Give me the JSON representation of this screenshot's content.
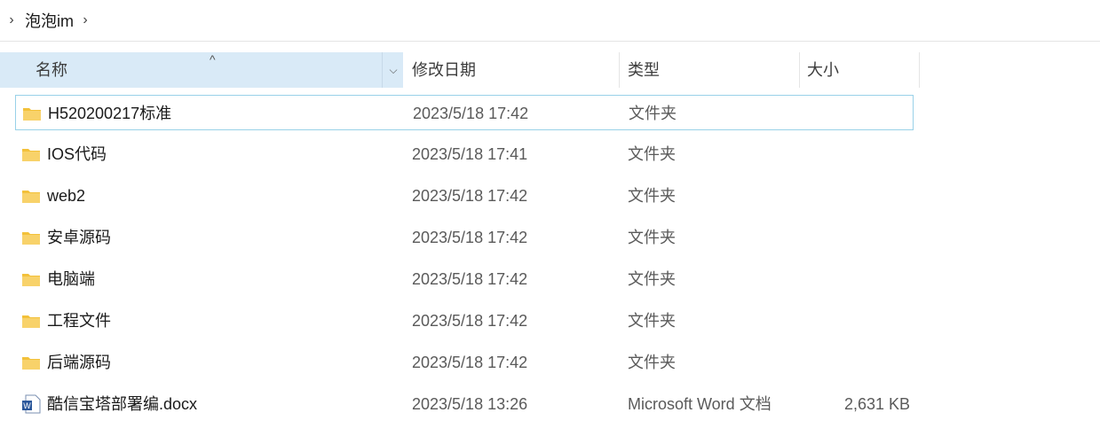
{
  "breadcrumb": {
    "items": [
      "泡泡im"
    ]
  },
  "columns": {
    "name": "名称",
    "date": "修改日期",
    "type": "类型",
    "size": "大小"
  },
  "files": [
    {
      "name": "H520200217标准",
      "date": "2023/5/18 17:42",
      "type": "文件夹",
      "size": "",
      "icon": "folder-icon",
      "selected": true
    },
    {
      "name": "IOS代码",
      "date": "2023/5/18 17:41",
      "type": "文件夹",
      "size": "",
      "icon": "folder-icon"
    },
    {
      "name": "web2",
      "date": "2023/5/18 17:42",
      "type": "文件夹",
      "size": "",
      "icon": "folder-icon"
    },
    {
      "name": "安卓源码",
      "date": "2023/5/18 17:42",
      "type": "文件夹",
      "size": "",
      "icon": "folder-icon"
    },
    {
      "name": "电脑端",
      "date": "2023/5/18 17:42",
      "type": "文件夹",
      "size": "",
      "icon": "folder-icon"
    },
    {
      "name": "工程文件",
      "date": "2023/5/18 17:42",
      "type": "文件夹",
      "size": "",
      "icon": "folder-icon"
    },
    {
      "name": "后端源码",
      "date": "2023/5/18 17:42",
      "type": "文件夹",
      "size": "",
      "icon": "folder-icon"
    },
    {
      "name": "酷信宝塔部署编.docx",
      "date": "2023/5/18 13:26",
      "type": "Microsoft Word 文档",
      "size": "2,631 KB",
      "icon": "word-document-icon"
    }
  ],
  "colors": {
    "header_selected_bg": "#d9eaf7",
    "selection_border": "#99d1e8",
    "folder": "#f3c13a",
    "word_blue": "#2b579a"
  }
}
